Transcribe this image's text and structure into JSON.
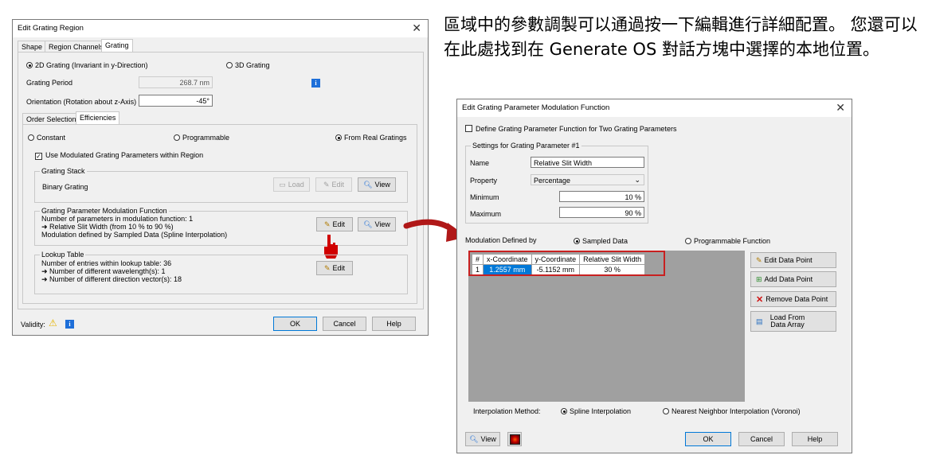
{
  "caption": "區域中的參數調製可以通過按一下編輯進行詳細配置。 您還可以在此處找到在 Generate OS 對話方塊中選擇的本地位置。",
  "left_dialog": {
    "title": "Edit Grating Region",
    "tabs": [
      "Shape",
      "Region Channels",
      "Grating"
    ],
    "grating_2d_label": "2D Grating (Invariant in y-Direction)",
    "grating_3d_label": "3D Grating",
    "grating_period_label": "Grating Period",
    "grating_period_value": "268.7 nm",
    "orientation_label": "Orientation (Rotation about z-Axis)",
    "orientation_value": "-45°",
    "subtabs": [
      "Order Selection",
      "Efficiencies"
    ],
    "radio_constant": "Constant",
    "radio_programmable": "Programmable",
    "radio_real": "From Real Gratings",
    "use_modulated_label": "Use Modulated Grating Parameters within Region",
    "grating_stack": {
      "legend": "Grating Stack",
      "value": "Binary Grating",
      "load": "Load",
      "edit": "Edit",
      "view": "View"
    },
    "modulation": {
      "legend": "Grating Parameter Modulation Function",
      "line1": "Number of parameters in modulation function: 1",
      "line2": "➜ Relative Slit Width (from 10 % to 90 %)",
      "line3": "Modulation defined by Sampled Data (Spline Interpolation)",
      "edit": "Edit",
      "view": "View"
    },
    "lookup": {
      "legend": "Lookup Table",
      "line1": "Number of entries within lookup table: 36",
      "line2": "➜ Number of different wavelength(s): 1",
      "line3": "➜ Number of different direction vector(s): 18",
      "edit": "Edit"
    },
    "validity_label": "Validity:",
    "ok": "OK",
    "cancel": "Cancel",
    "help": "Help"
  },
  "right_dialog": {
    "title": "Edit Grating Parameter Modulation Function",
    "two_params_label": "Define Grating Parameter Function for Two Grating Parameters",
    "settings_legend": "Settings for Grating Parameter #1",
    "name_label": "Name",
    "name_value": "Relative Slit Width",
    "property_label": "Property",
    "property_value": "Percentage",
    "minimum_label": "Minimum",
    "minimum_value": "10 %",
    "maximum_label": "Maximum",
    "maximum_value": "90 %",
    "modulation_label": "Modulation Defined by",
    "sampled_label": "Sampled Data",
    "programmable_label": "Programmable Function",
    "table": {
      "headers": [
        "#",
        "x-Coordinate",
        "y-Coordinate",
        "Relative Slit Width"
      ],
      "row": [
        "1",
        "1.2557 mm",
        "-5.1152 mm",
        "30 %"
      ]
    },
    "edit_point": "Edit Data Point",
    "add_point": "Add Data Point",
    "remove_point": "Remove Data Point",
    "load_array": "Load From Data Array",
    "interp_label": "Interpolation Method:",
    "spline_label": "Spline Interpolation",
    "nearest_label": "Nearest Neighbor Interpolation (Voronoi)",
    "view": "View",
    "ok": "OK",
    "cancel": "Cancel",
    "help": "Help"
  },
  "colors": {
    "highlight": "#e0202a",
    "selection": "#0078d7",
    "info_blue": "#1e6fd9"
  }
}
